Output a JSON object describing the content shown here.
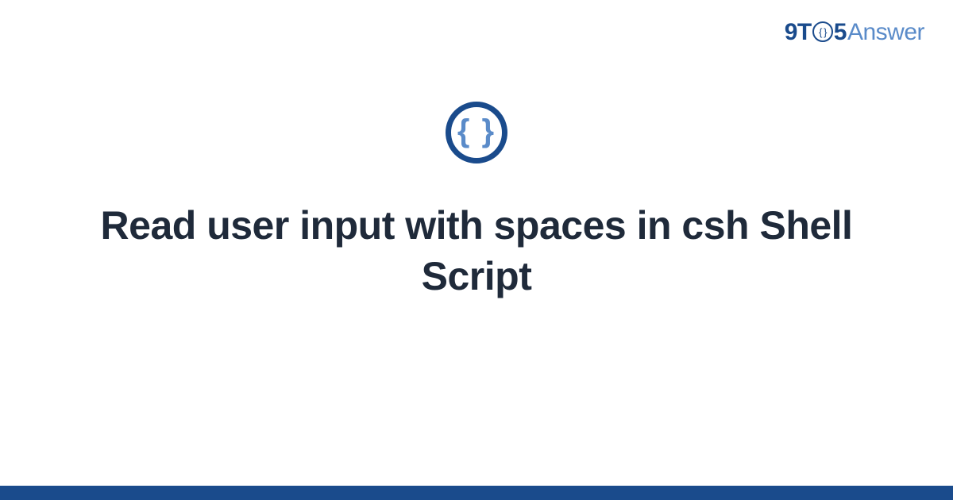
{
  "brand": {
    "part1": "9T",
    "part2_inner": "{ }",
    "part3": "5",
    "part4": "Answer"
  },
  "icon": {
    "braces": "{ }",
    "name": "code-braces-icon"
  },
  "title": "Read user input with spaces in csh Shell Script",
  "colors": {
    "primary": "#1a4b8c",
    "secondary": "#5a8bc9",
    "text": "#1f2a3a"
  }
}
